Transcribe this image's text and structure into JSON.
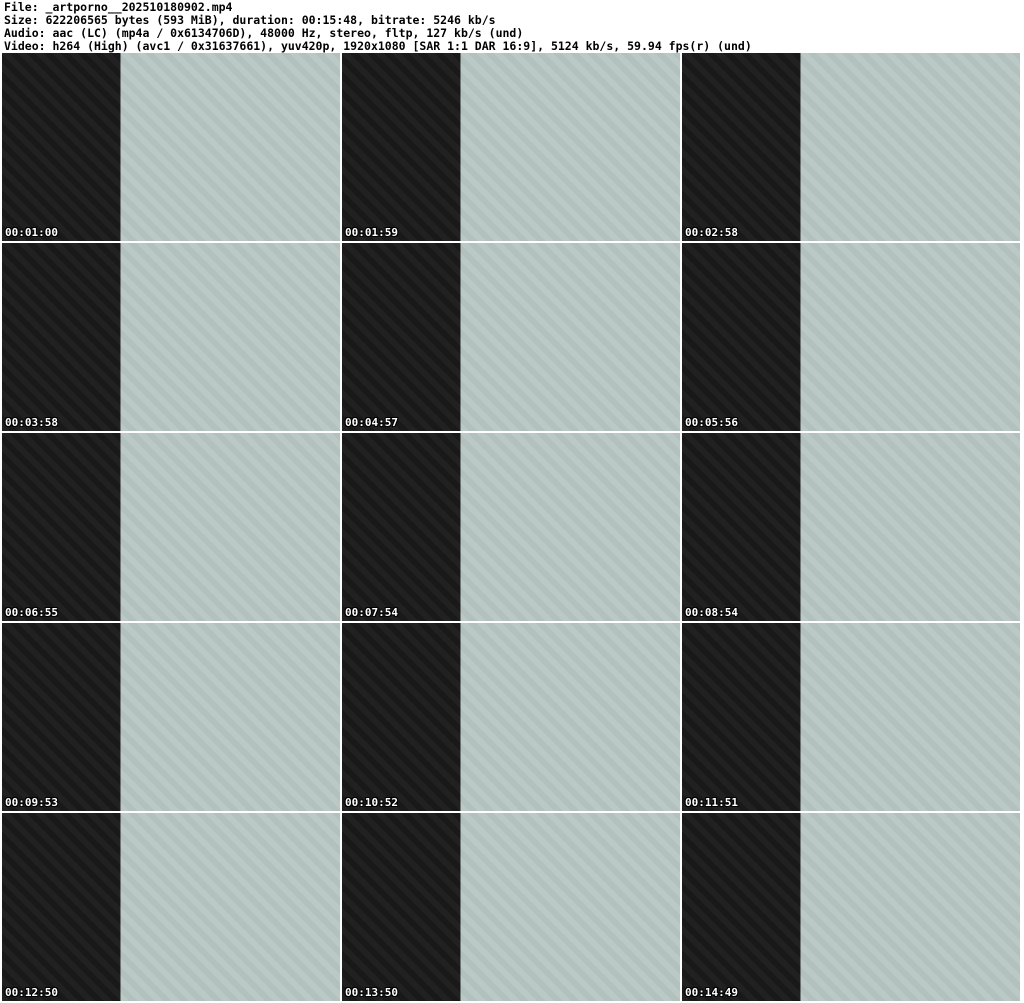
{
  "header": {
    "file": "File: _artporno__202510180902.mp4",
    "size": "Size: 622206565 bytes (593 MiB), duration: 00:15:48, bitrate: 5246 kb/s",
    "audio": "Audio: aac (LC) (mp4a / 0x6134706D), 48000 Hz, stereo, fltp, 127 kb/s (und)",
    "video": "Video: h264 (High) (avc1 / 0x31637661), yuv420p, 1920x1080 [SAR 1:1 DAR 16:9], 5124 kb/s, 59.94 fps(r) (und)"
  },
  "thumbnails": [
    {
      "timestamp": "00:01:00"
    },
    {
      "timestamp": "00:01:59"
    },
    {
      "timestamp": "00:02:58"
    },
    {
      "timestamp": "00:03:58"
    },
    {
      "timestamp": "00:04:57"
    },
    {
      "timestamp": "00:05:56"
    },
    {
      "timestamp": "00:06:55"
    },
    {
      "timestamp": "00:07:54"
    },
    {
      "timestamp": "00:08:54"
    },
    {
      "timestamp": "00:09:53"
    },
    {
      "timestamp": "00:10:52"
    },
    {
      "timestamp": "00:11:51"
    },
    {
      "timestamp": "00:12:50"
    },
    {
      "timestamp": "00:13:50"
    },
    {
      "timestamp": "00:14:49"
    }
  ]
}
